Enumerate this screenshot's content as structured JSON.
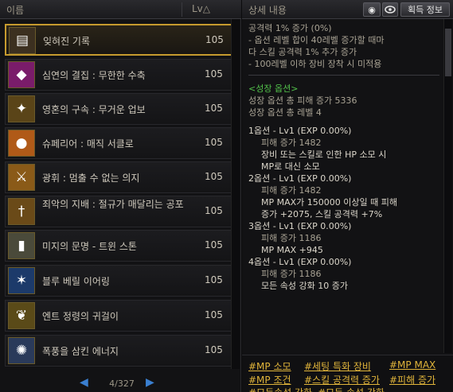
{
  "list": {
    "header_name": "이름",
    "header_lv": "Lv△",
    "items": [
      {
        "name": "잊혀진 기록",
        "lv": "105",
        "icon": "book-icon",
        "glyph": "▤",
        "bg": "#3c3020"
      },
      {
        "name": "심연의 결집 : 무한한 수축",
        "lv": "105",
        "icon": "purple-gem-icon",
        "glyph": "◆",
        "bg": "#7a1c6a"
      },
      {
        "name": "영혼의 구속 : 무거운 업보",
        "lv": "105",
        "icon": "staff-icon",
        "glyph": "✦",
        "bg": "#5a4418"
      },
      {
        "name": "슈페리어 : 매직 서클로",
        "lv": "105",
        "icon": "orb-icon",
        "glyph": "●",
        "bg": "#b05a18"
      },
      {
        "name": "광휘 : 멈출 수 없는 의지",
        "lv": "105",
        "icon": "blade-icon",
        "glyph": "⚔",
        "bg": "#8a5a18"
      },
      {
        "name": "죄악의 지배 : 절규가 매달리는 공포",
        "lv": "105",
        "icon": "dagger-icon",
        "glyph": "†",
        "bg": "#6a4a18"
      },
      {
        "name": "미지의 문명 - 트윈 스톤",
        "lv": "105",
        "icon": "stone-icon",
        "glyph": "▮",
        "bg": "#4a4a3a"
      },
      {
        "name": "블루 베릴 이어링",
        "lv": "105",
        "icon": "star-earring-icon",
        "glyph": "✶",
        "bg": "#1c3a6a"
      },
      {
        "name": "엔트 정령의 귀걸이",
        "lv": "105",
        "icon": "leaf-earring-icon",
        "glyph": "❦",
        "bg": "#5a4a18"
      },
      {
        "name": "폭풍을 삼킨 에너지",
        "lv": "105",
        "icon": "energy-icon",
        "glyph": "✺",
        "bg": "#2a3a5a"
      }
    ]
  },
  "pager": {
    "prev": "◀",
    "text": "4/327",
    "next": "▶"
  },
  "detail": {
    "title": "상세 내용",
    "btn_eye": "◉",
    "btn_obtain": "획득 정보",
    "lines_top": [
      "공격력 1% 증가 (0%)",
      "- 옵션 레벨 합이 40레벨 증가할 때마",
      "다 스킬 공격력 1% 추가 증가",
      "- 100레벨 이하 장비 장착 시 미적용"
    ],
    "growth_title": "<성장 옵션>",
    "growth_lines": [
      "성장 옵션 총 피해 증가 5336",
      "성장 옵션 총 레벨 4"
    ],
    "options": [
      {
        "head": "1옵션 - Lv1 (EXP 0.00%)",
        "sub": "피해 증가 1482",
        "body": [
          "장비 또는 스킬로 인한 HP 소모 시",
          "MP로 대신 소모"
        ]
      },
      {
        "head": "2옵션 - Lv1 (EXP 0.00%)",
        "sub": "피해 증가 1482",
        "body": [
          "MP MAX가 150000 이상일 때 피해",
          "증가 +2075, 스킬 공격력 +7%"
        ]
      },
      {
        "head": "3옵션 - Lv1 (EXP 0.00%)",
        "sub": "피해 증가 1186",
        "body": [
          "MP MAX +945"
        ]
      },
      {
        "head": "4옵션 - Lv1 (EXP 0.00%)",
        "sub": "피해 증가 1186",
        "body": [
          "모든 속성 강화 10 증가"
        ]
      }
    ],
    "tags": [
      "#MP 소모",
      "#세팅 특화 장비",
      "#MP MAX",
      "#MP 조건",
      "#스킬 공격력 증가",
      "#피해 증가",
      "#모든속성 강화",
      "#모든 속성 강화"
    ]
  }
}
